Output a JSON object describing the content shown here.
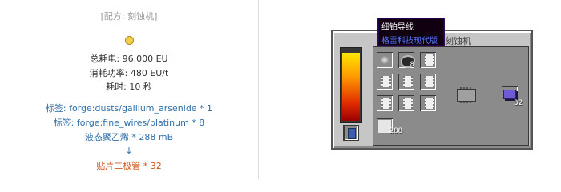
{
  "recipe": {
    "machine": "[配方: 刻蚀机]",
    "icon": "lightbulb-icon",
    "energy": "总耗电: 96,000 EU",
    "power": "消耗功率: 480 EU/t",
    "time": "耗时: 10 秒",
    "inputs": [
      "标签: forge:dusts/gallium_arsenide * 1",
      "标签: forge:fine_wires/platinum * 8",
      "液态聚乙烯 * 288 mB"
    ],
    "arrow": "↓",
    "output": "贴片二极管 * 32"
  },
  "gui": {
    "title": "刻蚀机",
    "energy_level": 0.96,
    "colors": {
      "energy_top": "#ffe600",
      "energy_bottom": "#9a0000",
      "tooltip_mod": "#5577ff"
    },
    "slots": {
      "input_dust": {
        "icon": "dust-icon"
      },
      "input_wires": {
        "icon": "wires-icon",
        "count": "8"
      },
      "fluid": {
        "icon": "fluid-icon",
        "count": "288"
      },
      "output": {
        "icon": "chip-icon",
        "count": "32"
      }
    },
    "tooltip": {
      "title": "细铂导线",
      "mod": "格雷科技现代版"
    }
  }
}
